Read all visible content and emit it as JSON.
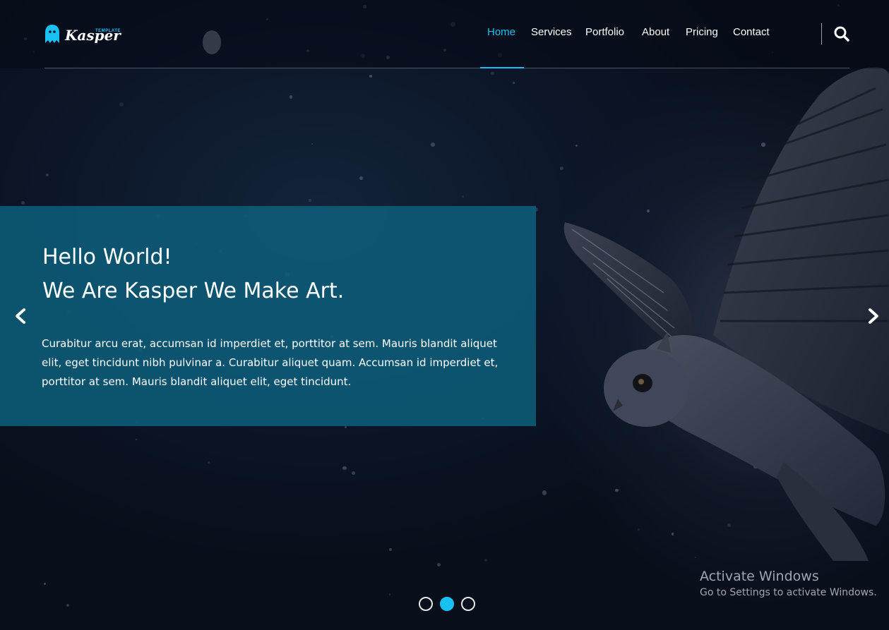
{
  "brand": {
    "name": "Kasper",
    "tagline": "TEMPLATE",
    "accent_color": "#19c0f2",
    "icon": "ghost-icon"
  },
  "nav": {
    "items": [
      {
        "label": "Home",
        "active": true
      },
      {
        "label": "Services",
        "active": false
      },
      {
        "label": "Portfolio",
        "active": false
      },
      {
        "label": "About",
        "active": false
      },
      {
        "label": "Pricing",
        "active": false
      },
      {
        "label": "Contact",
        "active": false
      }
    ],
    "search_icon": "search-icon"
  },
  "slider": {
    "title_line1": "Hello World!",
    "title_line2": "We Are Kasper We Make Art.",
    "description": "Curabitur arcu erat, accumsan id imperdiet et, porttitor at sem. Mauris blandit aliquet elit, eget tincidunt nibh pulvinar a. Curabitur aliquet quam. Accumsan id imperdiet et, porttitor at sem. Mauris blandit aliquet elit, eget tincidunt.",
    "prev_icon": "chevron-left-icon",
    "next_icon": "chevron-right-icon",
    "active_slide": 2,
    "slide_count": 3,
    "panel_color": "#0d5c79"
  },
  "watermark": {
    "title": "Activate Windows",
    "subtitle": "Go to Settings to activate Windows."
  }
}
